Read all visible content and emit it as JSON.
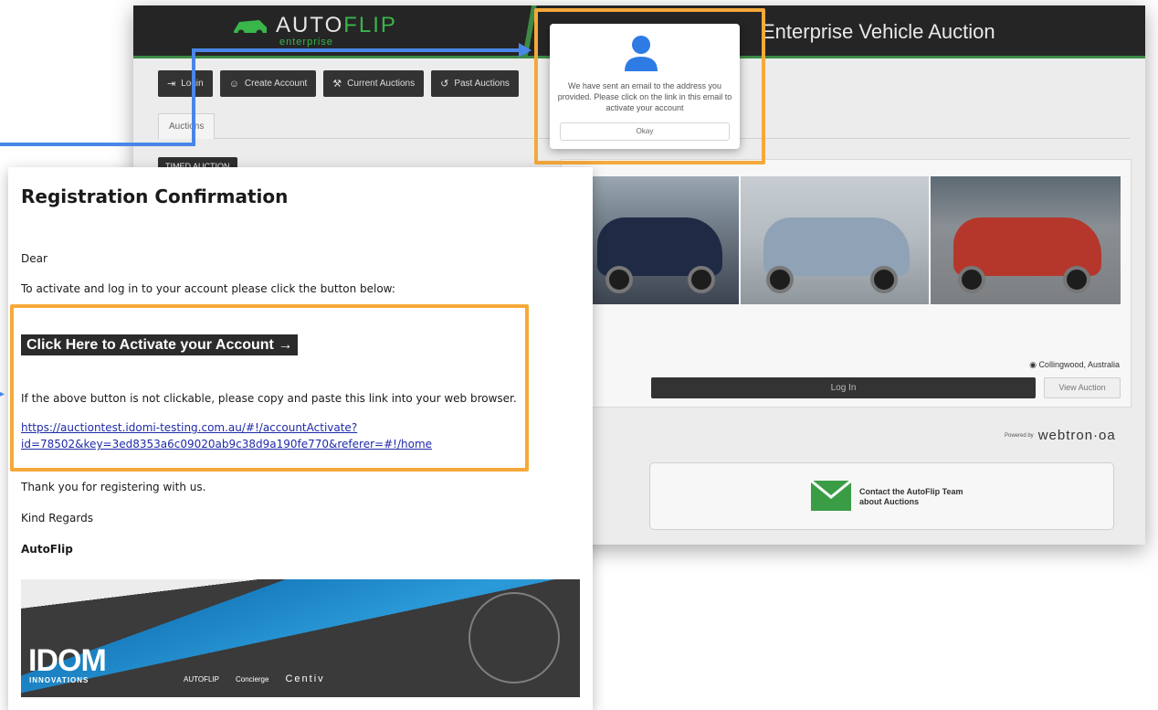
{
  "site": {
    "logo_main": "AUTO",
    "logo_accent": "FLIP",
    "logo_sub": "enterprise",
    "title": "Enterprise Vehicle Auction",
    "nav": [
      {
        "label": "Login",
        "icon": "login-icon"
      },
      {
        "label": "Create Account",
        "icon": "add-user-icon"
      },
      {
        "label": "Current Auctions",
        "icon": "gavel-icon"
      },
      {
        "label": "Past Auctions",
        "icon": "history-icon"
      }
    ],
    "tab_label": "Auctions",
    "badge": "TIMED AUCTION",
    "location": "Collingwood, Australia",
    "login_button": "Log In",
    "view_button": "View Auction",
    "powered_prefix": "Powered by",
    "powered_brand": "webtron·oa",
    "contact_text": "Contact the AutoFlip Team about Auctions"
  },
  "modal": {
    "message": "We have sent an email to the address you provided. Please click on the link in this email to activate your account",
    "button": "Okay"
  },
  "email": {
    "title": "Registration Confirmation",
    "greeting": "Dear",
    "intro": "To activate and log in to your account please click the button below:",
    "activate_button": "Click Here to Activate your Account →",
    "fallback_text": "If the above button is not clickable, please copy and paste this link into your web browser.",
    "link": "https://auctiontest.idomi-testing.com.au/#!/accountActivate?id=78502&key=3ed8353a6c09020ab9c38d9a190fe770&referer=#!/home",
    "thanks": "Thank you for registering with us.",
    "regards": "Kind Regards",
    "sender": "AutoFlip"
  },
  "banner": {
    "brand": "IDOM",
    "brand_sub": "INNOVATIONS",
    "partners": [
      "AUTOFLIP",
      "Concierge",
      "Centiv"
    ]
  },
  "colors": {
    "callout": "#f5a93a",
    "connector": "#4a86e8",
    "brand_green": "#39b54a"
  }
}
